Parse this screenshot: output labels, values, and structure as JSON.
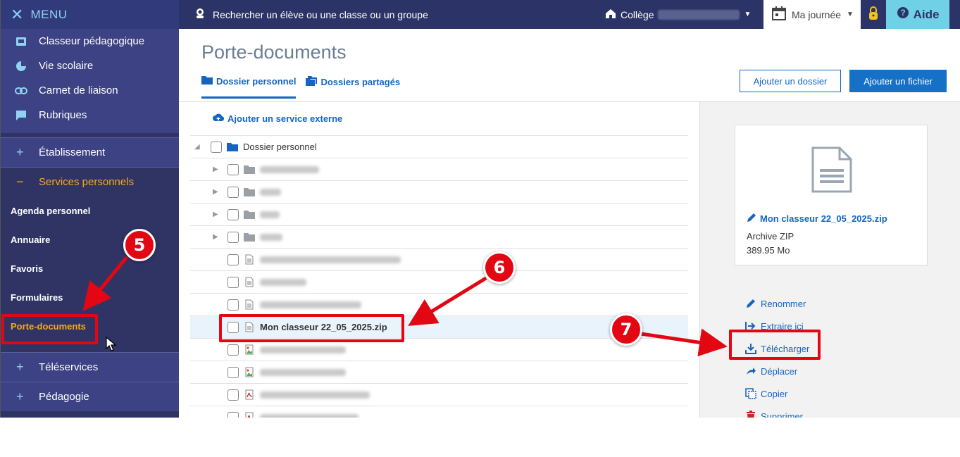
{
  "menu": {
    "label": "MENU"
  },
  "sidebar": {
    "top_items": [
      {
        "label": "Classeur pédagogique",
        "icon": "binder-icon"
      },
      {
        "label": "Vie scolaire",
        "icon": "pie-icon"
      },
      {
        "label": "Carnet de liaison",
        "icon": "link-icon"
      },
      {
        "label": "Rubriques",
        "icon": "chat-icon"
      }
    ],
    "sections": {
      "etablissement": "Établissement",
      "services": "Services personnels",
      "teleservices": "Téléservices",
      "pedagogie": "Pédagogie"
    },
    "sub_items": [
      "Agenda personnel",
      "Annuaire",
      "Favoris",
      "Formulaires",
      "Porte-documents"
    ]
  },
  "topbar": {
    "search_text": "Rechercher un élève ou une classe ou un groupe",
    "college_label": "Collège",
    "ma_journee": "Ma journée",
    "aide": "Aide"
  },
  "main": {
    "title": "Porte-documents",
    "tabs": [
      "Dossier personnel",
      "Dossiers partagés"
    ],
    "add_folder": "Ajouter un dossier",
    "add_file": "Ajouter un fichier",
    "add_external": "Ajouter un service externe",
    "root_folder": "Dossier personnel",
    "selected_file": "Mon classeur 22_05_2025.zip"
  },
  "details": {
    "file_name": "Mon classeur 22_05_2025.zip",
    "file_type": "Archive ZIP",
    "file_size": "389.95 Mo",
    "actions": [
      "Renommer",
      "Extraire ici",
      "Télécharger",
      "Déplacer",
      "Copier",
      "Supprimer"
    ]
  },
  "annotations": {
    "step5": "5",
    "step6": "6",
    "step7": "7"
  },
  "colors": {
    "accent": "#1565c0",
    "sidebar": "#2f3465",
    "active": "#f6a81d",
    "annotation": "#e30613"
  }
}
